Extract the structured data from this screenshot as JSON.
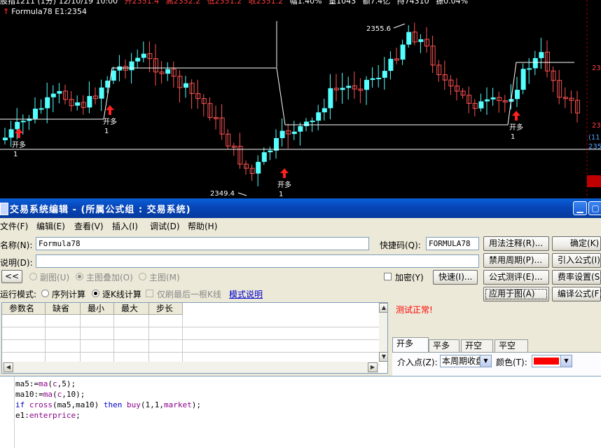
{
  "chart": {
    "top_info": {
      "name": "股指1211 (1分) 12/10/19 10:00",
      "open": "开2351.4",
      "high": "高2352.2",
      "low": "低2351.2",
      "close": "收2351.2",
      "change": "幅1.40%",
      "volume": "量1043",
      "amount": "额7.4亿",
      "position": "持74310",
      "amplitude": "振0.04%"
    },
    "formula_line": "Formula78  E1:2354",
    "high_label": "2355.6",
    "low_label": "2349.4",
    "signal_label": "开多",
    "signal_count": "1",
    "right_price_1": "23",
    "right_price_2": "23",
    "right_price_3": "(11",
    "right_price_4": "235",
    "colors": {
      "up": "#54ffff",
      "down": "#ff5252",
      "line": "#ffffff",
      "signal": "#ff2020"
    }
  },
  "dialog": {
    "title": "交易系统编辑 - (所属公式组 : 交易系统)",
    "menu": [
      "文件(F)",
      "编辑(E)",
      "查看(V)",
      "插入(I)",
      "调试(D)",
      "帮助(H)"
    ],
    "name_label": "名称(N):",
    "name_value": "Formula78",
    "shortcut_label": "快捷码(Q):",
    "shortcut_value": "FORMULA78",
    "desc_label": "说明(D):",
    "desc_value": "",
    "collapse_btn": "<<",
    "radio_subchart": "副图(U)",
    "radio_overlay": "主图叠加(O)",
    "radio_main": "主图(M)",
    "encrypt_label": "加密(Y)",
    "fast_btn": "快速(I)...",
    "run_mode_label": "运行模式:",
    "radio_seq": "序列计算",
    "radio_bar": "逐K线计算",
    "refresh_last_label": "仅刷最后一根K线",
    "mode_link": "模式说明",
    "table_headers": [
      "参数名",
      "缺省",
      "最小",
      "最大",
      "步长"
    ],
    "test_result": "测试正常!",
    "tabs": [
      "开多",
      "平多",
      "开空",
      "平空"
    ],
    "entry_label": "介入点(Z):",
    "entry_value": "本周期收盘",
    "color_label": "颜色(T):",
    "color_value": "#ff0000",
    "buttons_col1": [
      "用法注释(R)...",
      "禁用周期(P)...",
      "公式测评(E)...",
      "应用于图(A)"
    ],
    "buttons_col2": [
      "确定(K)",
      "引入公式(I)",
      "费率设置(S)",
      "编译公式(F)"
    ],
    "code_lines": [
      "ma5:=ma(c,5);",
      "ma10:=ma(c,10);",
      "if cross(ma5,ma10) then buy(1,1,market);",
      "e1:enterprice;"
    ]
  }
}
